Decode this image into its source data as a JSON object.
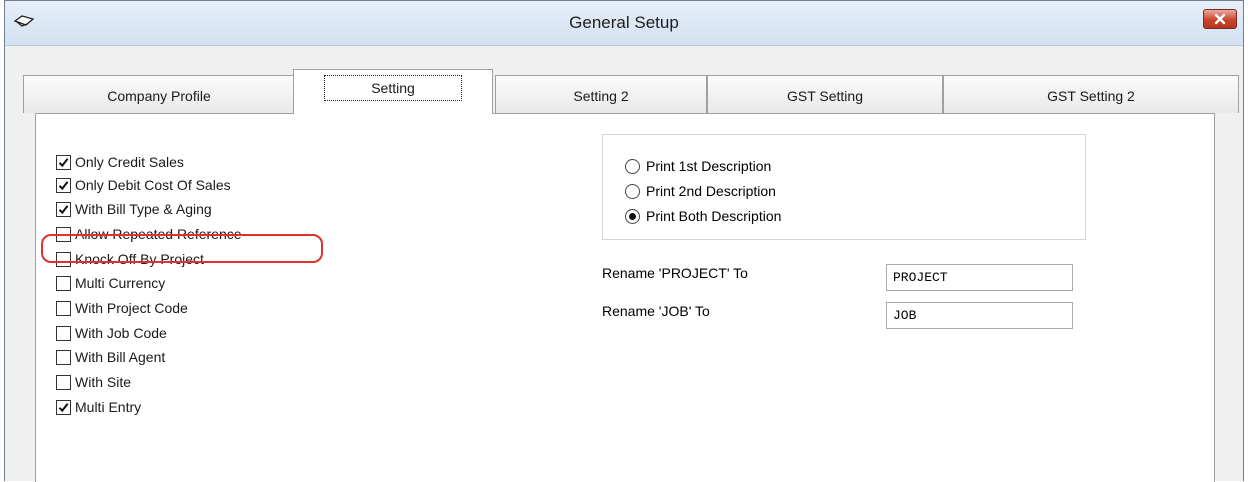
{
  "window": {
    "title": "General Setup"
  },
  "tabs": [
    {
      "label": "Company Profile"
    },
    {
      "label": "Setting"
    },
    {
      "label": "Setting 2"
    },
    {
      "label": "GST Setting"
    },
    {
      "label": "GST Setting 2"
    }
  ],
  "active_tab": "Setting",
  "options": [
    {
      "label": "Only Credit Sales",
      "checked": true
    },
    {
      "label": "Only Debit Cost Of Sales",
      "checked": true
    },
    {
      "label": "With Bill Type & Aging",
      "checked": true
    },
    {
      "label": "Allow Repeated Reference",
      "checked": false
    },
    {
      "label": "Knock Off By Project",
      "checked": false
    },
    {
      "label": "Multi Currency",
      "checked": false
    },
    {
      "label": "With Project Code",
      "checked": false
    },
    {
      "label": "With Job Code",
      "checked": false
    },
    {
      "label": "With Bill Agent",
      "checked": false
    },
    {
      "label": "With Site",
      "checked": false
    },
    {
      "label": "Multi Entry",
      "checked": true
    }
  ],
  "print_options": [
    {
      "label": "Print 1st Description",
      "selected": false
    },
    {
      "label": "Print 2nd Description",
      "selected": false
    },
    {
      "label": "Print Both Description",
      "selected": true
    }
  ],
  "rename": {
    "project_label": "Rename 'PROJECT' To",
    "project_value": "PROJECT",
    "job_label": "Rename 'JOB' To",
    "job_value": "JOB"
  },
  "colors": {
    "highlight": "#e0332b",
    "close_button": "#c9452f"
  }
}
